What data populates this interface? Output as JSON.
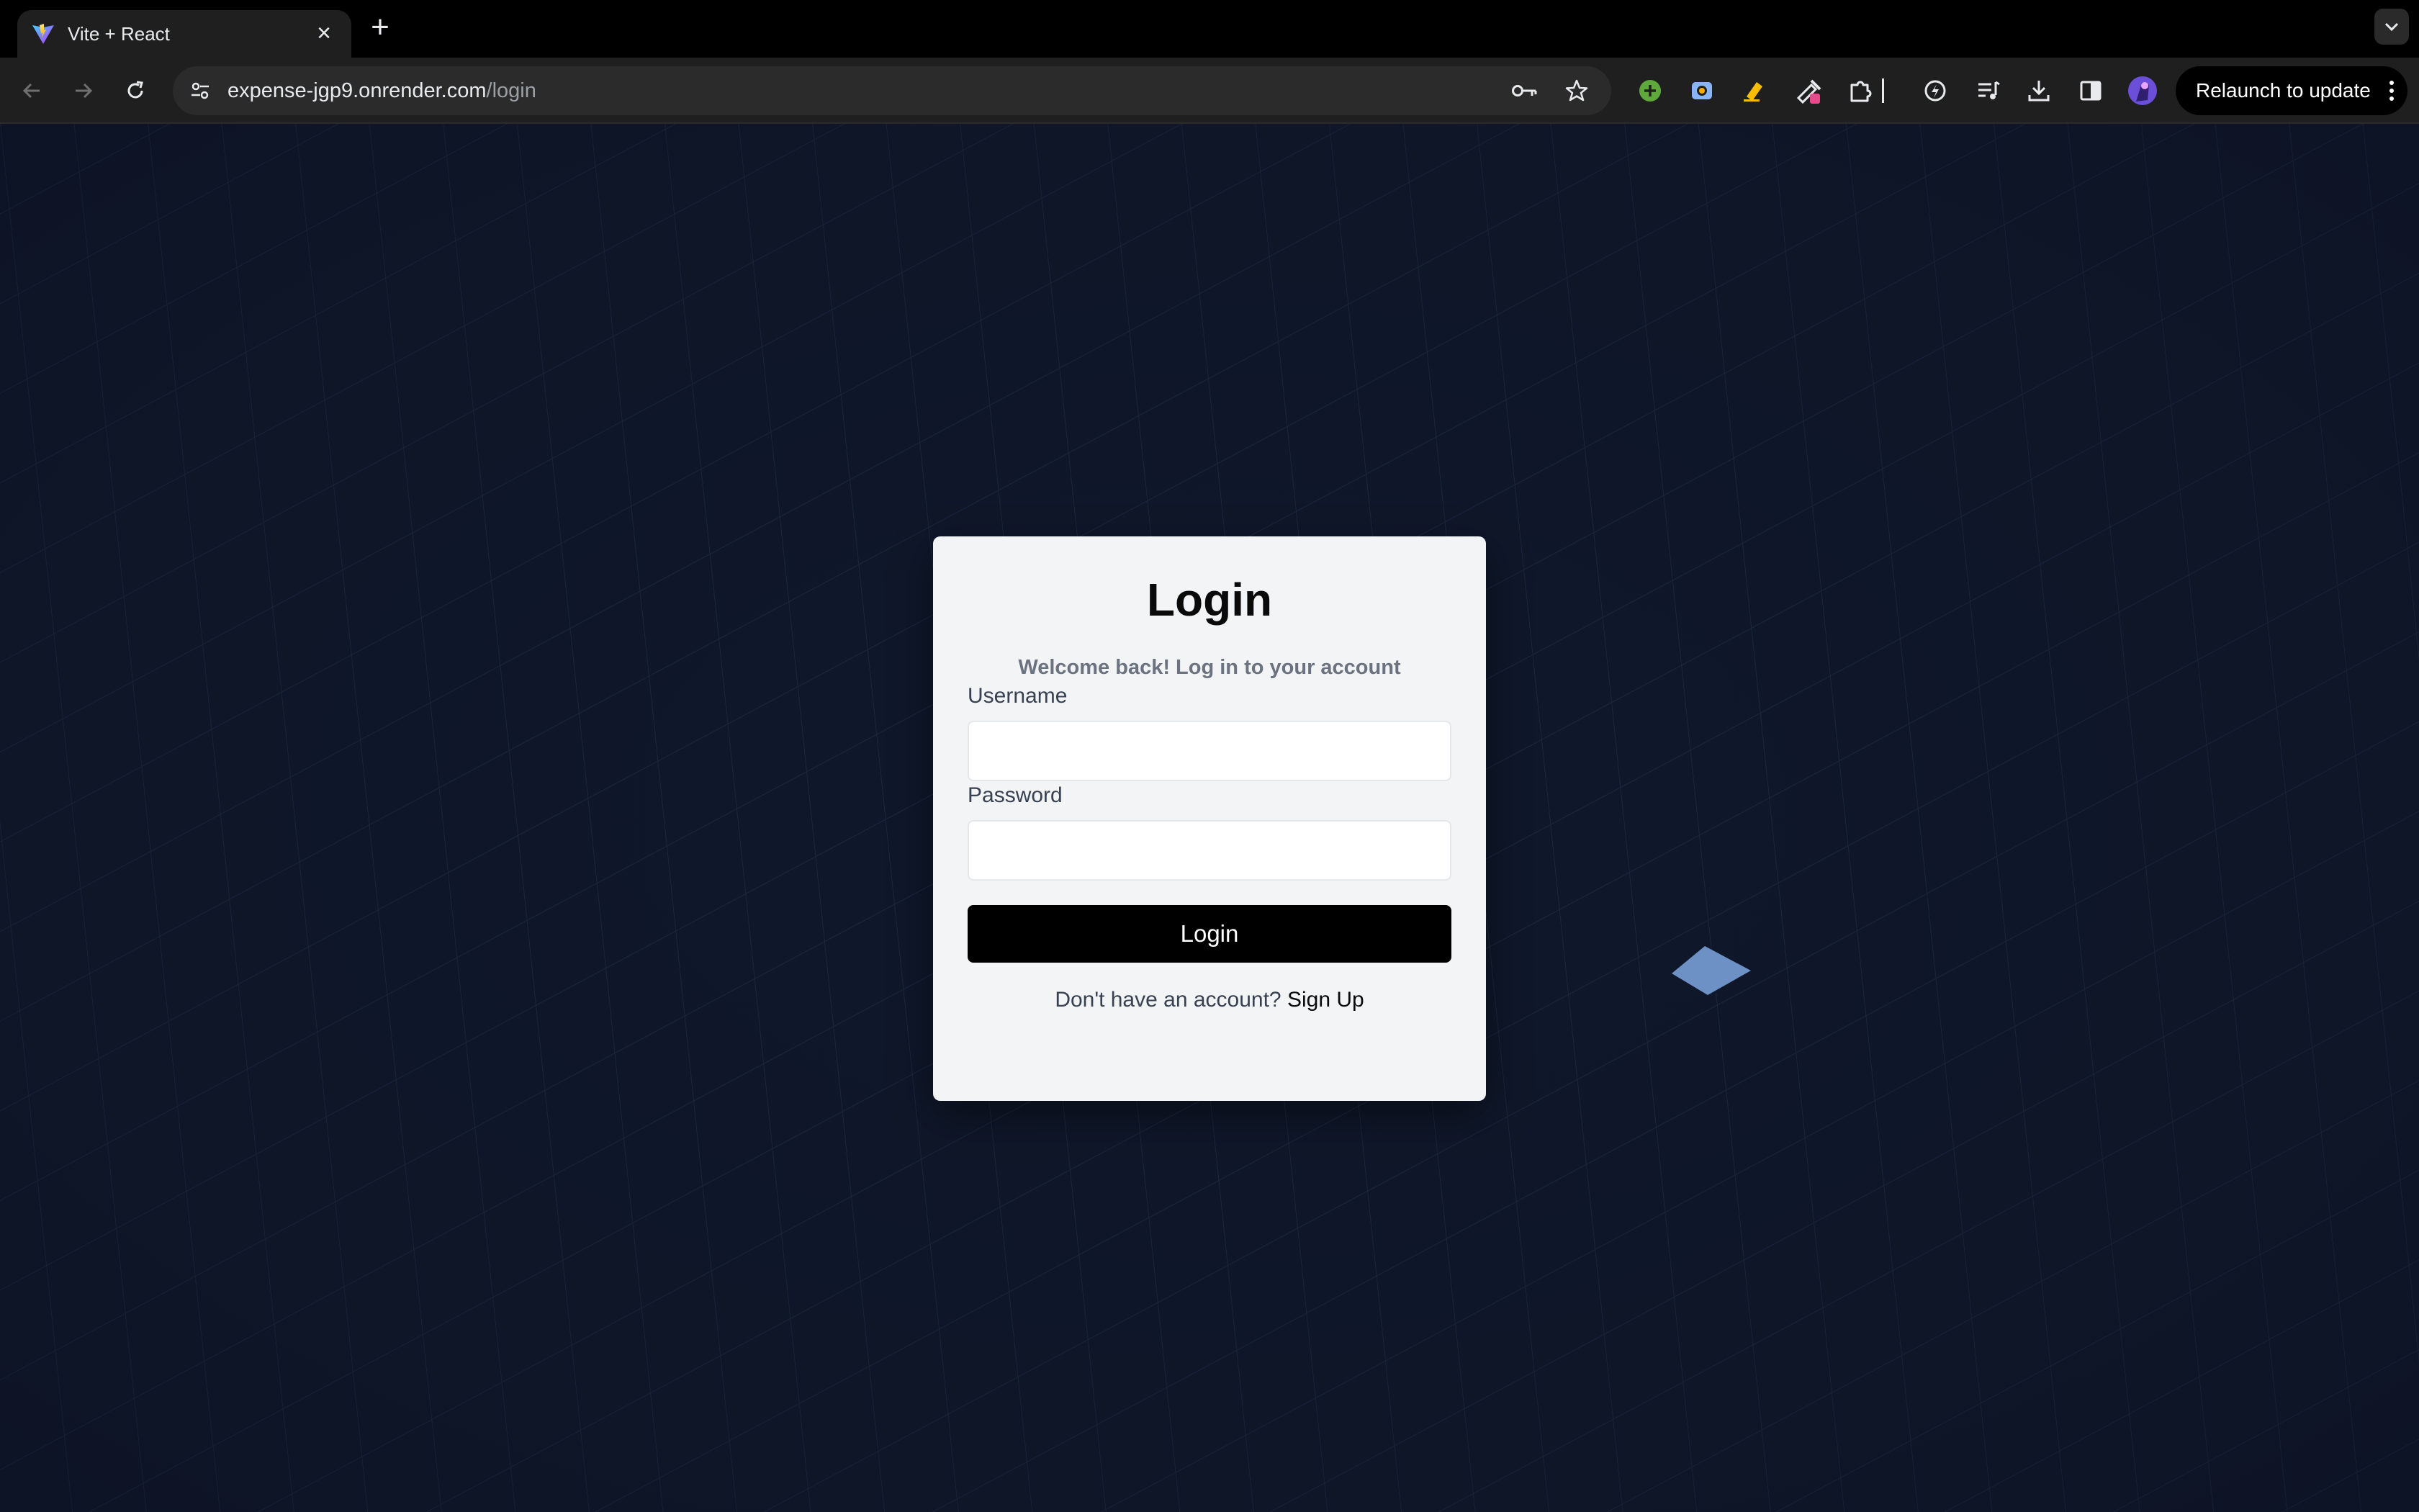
{
  "browser": {
    "tab": {
      "title": "Vite + React",
      "favicon_icon": "vite-logo-icon",
      "close_icon": "close-icon"
    },
    "new_tab_icon": "plus-icon",
    "tab_list_icon": "chevron-down-icon",
    "url": {
      "host": "expense-jgp9.onrender.com",
      "path": "/login"
    },
    "toolbar_icons": [
      "back-icon",
      "forward-icon",
      "reload-icon",
      "site-info-icon",
      "key-icon",
      "star-icon"
    ],
    "extension_icons": [
      "green-plus-extension-icon",
      "camera-extension-icon",
      "highlighter-extension-icon",
      "eyedropper-extension-icon",
      "puzzle-extensions-icon",
      "bolt-extension-icon",
      "media-queue-icon",
      "download-icon",
      "side-panel-icon",
      "profile-avatar-icon"
    ],
    "relaunch_label": "Relaunch to update"
  },
  "login": {
    "title": "Login",
    "subtitle": "Welcome back! Log in to your account",
    "username_label": "Username",
    "username_value": "",
    "password_label": "Password",
    "password_value": "",
    "submit_label": "Login",
    "signup_prompt": "Don't have an account?",
    "signup_link": "Sign Up"
  },
  "colors": {
    "page_background": "#0f172a",
    "card_background": "#f3f4f6",
    "button_background": "#000000",
    "accent_tile": "#7ea6e0"
  }
}
